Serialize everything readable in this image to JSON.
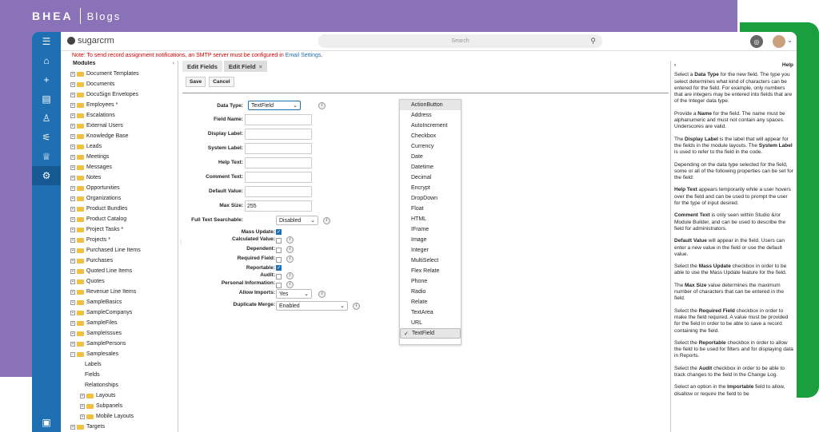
{
  "brand": {
    "left": "BHEA",
    "right": "Blogs"
  },
  "topbar": {
    "logo": "sugarcrm",
    "search_placeholder": "Search"
  },
  "notice": {
    "text": "Note: To send record assignment notifications, an SMTP server must be configured in ",
    "link": "Email Settings",
    "end": "."
  },
  "tree": {
    "header": "Modules",
    "items": [
      "Document Templates",
      "Documents",
      "DocuSign Envelopes",
      "Employees *",
      "Escalations",
      "External Users",
      "Knowledge Base",
      "Leads",
      "Meetings",
      "Messages",
      "Notes",
      "Opportunities",
      "Organizations",
      "Product Bundles",
      "Product Catalog",
      "Project Tasks *",
      "Projects *",
      "Purchased Line Items",
      "Purchases",
      "Quoted Line Items",
      "Quotes",
      "Revenue Line Items",
      "SampleBasics",
      "SampleCompanys",
      "SampleFiles",
      "SampleIssues",
      "SamplePersons",
      "Samplesales"
    ],
    "children": [
      "Labels",
      "Fields",
      "Relationships"
    ],
    "subfolders": [
      "Layouts",
      "Subpanels",
      "Mobile Layouts"
    ],
    "after": [
      "Targets"
    ]
  },
  "tabs": [
    {
      "label": "Edit Fields"
    },
    {
      "label": "Edit Field",
      "close": "×"
    }
  ],
  "buttons": {
    "save": "Save",
    "cancel": "Cancel"
  },
  "form": {
    "data_type_label": "Data Type:",
    "data_type_value": "TextField",
    "field_name_label": "Field Name:",
    "display_label_label": "Display Label:",
    "system_label_label": "System Label:",
    "help_text_label": "Help Text:",
    "comment_text_label": "Comment Text:",
    "default_value_label": "Default Value:",
    "max_size_label": "Max Size:",
    "max_size_value": "255",
    "full_text_label": "Full Text Searchable:",
    "full_text_value": "Disabled",
    "mass_update_label": "Mass Update:",
    "calculated_label": "Calculated Value:",
    "dependent_label": "Dependent:",
    "required_label": "Required Field:",
    "reportable_label": "Reportable:",
    "audit_label": "Audit:",
    "personal_label": "Personal Information:",
    "allow_imports_label": "Allow Imports:",
    "allow_imports_value": "Yes",
    "duplicate_label": "Duplicate Merge:",
    "duplicate_value": "Enabled"
  },
  "dropdown": [
    "ActionButton",
    "Address",
    "AutoIncrement",
    "Checkbox",
    "Currency",
    "Date",
    "Datetime",
    "Decimal",
    "Encrypt",
    "DropDown",
    "Float",
    "HTML",
    "IFrame",
    "Image",
    "Integer",
    "MultiSelect",
    "Flex Relate",
    "Phone",
    "Radio",
    "Relate",
    "TextArea",
    "URL",
    "TextField"
  ],
  "help": {
    "title": "Help",
    "p1a": "Select a ",
    "p1b": "Data Type",
    "p1c": " for the new field. The type you select determines what kind of characters can be entered for the field. For example, only numbers that are integers may be entered into fields that are of the Integer data type.",
    "p2a": "Provide a ",
    "p2b": "Name",
    "p2c": " for the field. The name must be alphanumeric and must not contain any spaces. Underscores are valid.",
    "p3a": "The ",
    "p3b": "Display Label",
    "p3c": " is the label that will appear for the fields in the module layouts. The ",
    "p3d": "System Label",
    "p3e": " is used to refer to the field in the code.",
    "p4": "Depending on the data type selected for the field, some or all of the following properties can be set for the field:",
    "p5a": "Help Text",
    "p5b": " appears temporarily while a user hovers over the field and can be used to prompt the user for the type of input desired.",
    "p6a": "Comment Text",
    "p6b": " is only seen within Studio &/or Module Builder, and can be used to describe the field for administrators.",
    "p7a": "Default Value",
    "p7b": " will appear in the field. Users can enter a new value in the field or use the default value.",
    "p8a": "Select the ",
    "p8b": "Mass Update",
    "p8c": " checkbox in order to be able to use the Mass Update feature for the field.",
    "p9a": "The ",
    "p9b": "Max Size",
    "p9c": " value determines the maximum number of characters that can be entered in the field.",
    "p10a": "Select the ",
    "p10b": "Required Field",
    "p10c": " checkbox in order to make the field required. A value must be provided for the field in order to be able to save a record containing the field.",
    "p11a": "Select the ",
    "p11b": "Reportable",
    "p11c": " checkbox in order to allow the field to be used for filters and for displaying data in Reports.",
    "p12a": "Select the ",
    "p12b": "Audit",
    "p12c": " checkbox in order to be able to track changes to the field in the Change Log.",
    "p13a": "Select an option in the ",
    "p13b": "Importable",
    "p13c": " field to allow, disallow or require the field to be"
  }
}
